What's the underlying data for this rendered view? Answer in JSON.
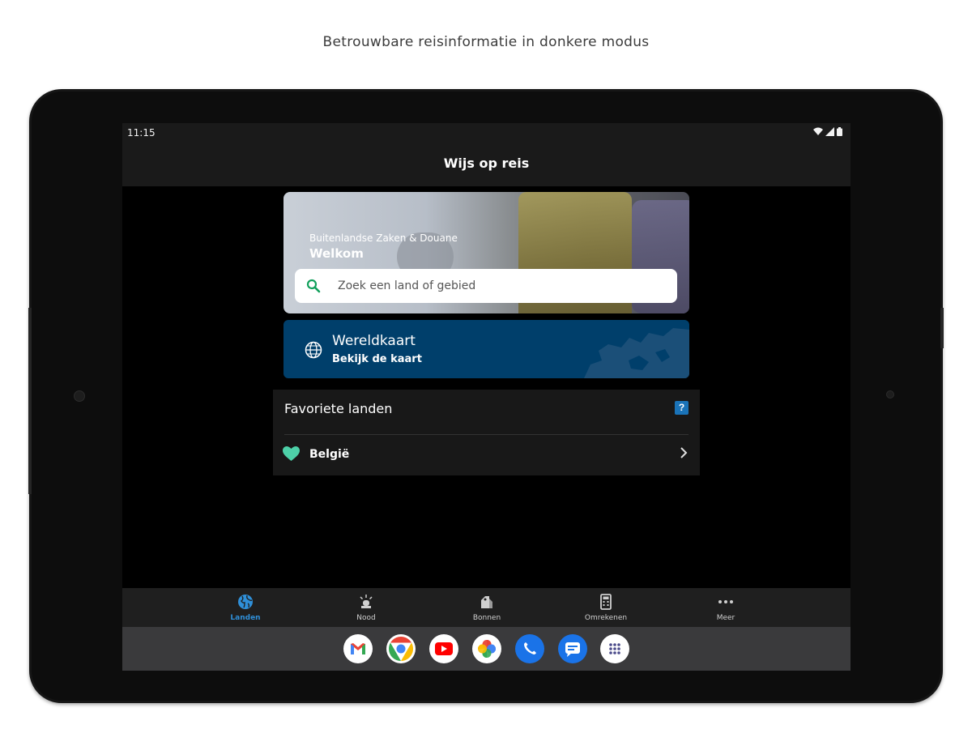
{
  "caption": "Betrouwbare reisinformatie in donkere modus",
  "status_bar": {
    "time": "11:15",
    "icons": [
      "wifi-icon",
      "signal-icon",
      "battery-icon"
    ]
  },
  "app_bar": {
    "title": "Wijs op reis"
  },
  "hero": {
    "subtitle": "Buitenlandse Zaken & Douane",
    "title": "Welkom",
    "search_placeholder": "Zoek een land of gebied"
  },
  "map_card": {
    "title": "Wereldkaart",
    "subtitle": "Bekijk de kaart"
  },
  "favorites": {
    "heading": "Favoriete landen",
    "help_label": "?",
    "items": [
      {
        "name": "België"
      }
    ]
  },
  "bottom_nav": {
    "items": [
      {
        "label": "Landen",
        "icon": "globe-icon",
        "active": true
      },
      {
        "label": "Nood",
        "icon": "siren-icon",
        "active": false
      },
      {
        "label": "Bonnen",
        "icon": "coupons-icon",
        "active": false
      },
      {
        "label": "Omrekenen",
        "icon": "calculator-icon",
        "active": false
      },
      {
        "label": "Meer",
        "icon": "more-icon",
        "active": false
      }
    ]
  },
  "dock": {
    "apps": [
      "gmail-icon",
      "chrome-icon",
      "youtube-icon",
      "photos-icon",
      "phone-icon",
      "messages-icon",
      "app-drawer-icon"
    ]
  },
  "colors": {
    "accent": "#2f8fd8",
    "map_card": "#003f6b",
    "heart": "#4dd0a8",
    "search_icon": "#12a05c"
  }
}
